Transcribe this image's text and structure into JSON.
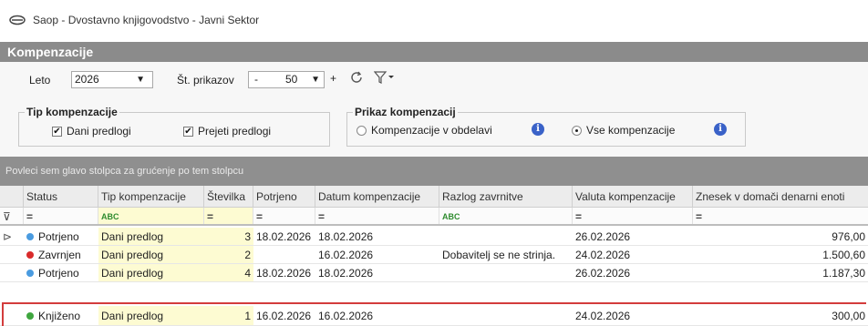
{
  "window": {
    "title": "Saop - Dvostavno knjigovodstvo - Javni Sektor"
  },
  "panel": {
    "title": "Kompenzacije"
  },
  "toolbar": {
    "year_label": "Leto",
    "year_value": "2026",
    "count_label": "Št. prikazov",
    "count_minus": "-",
    "count_value": "50",
    "count_plus": "+"
  },
  "tip_group": {
    "title": "Tip kompenzacije",
    "option1": "Dani predlogi",
    "option2": "Prejeti predlogi"
  },
  "prikaz_group": {
    "title": "Prikaz kompenzacij",
    "option1": "Kompenzacije v obdelavi",
    "option2": "Vse kompenzacije"
  },
  "group_bar": {
    "text": "Povleci sem glavo stolpca za grućenje po tem stolpcu"
  },
  "columns": [
    "Status",
    "Tip kompenzacije",
    "Številka",
    "Potrjeno",
    "Datum kompenzacije",
    "Razlog zavrnitve",
    "Valuta kompenzacije",
    "Znesek v domači denarni enoti"
  ],
  "filter_row": [
    "=",
    "ABC",
    "=",
    "=",
    "=",
    "ABC",
    "=",
    "="
  ],
  "rows": [
    {
      "status": "Potrjeno",
      "status_color": "#4a9be0",
      "tip": "Dani predlog",
      "stevilka": "3",
      "potrjeno": "18.02.2026",
      "datum": "18.02.2026",
      "razlog": "",
      "valuta": "26.02.2026",
      "znesek": "976,00"
    },
    {
      "status": "Zavrnjen",
      "status_color": "#d92b2b",
      "tip": "Dani predlog",
      "stevilka": "2",
      "potrjeno": "",
      "datum": "16.02.2026",
      "razlog": "Dobavitelj se ne strinja.",
      "valuta": "24.02.2026",
      "znesek": "1.500,60"
    },
    {
      "status": "Potrjeno",
      "status_color": "#4a9be0",
      "tip": "Dani predlog",
      "stevilka": "4",
      "potrjeno": "18.02.2026",
      "datum": "18.02.2026",
      "razlog": "",
      "valuta": "26.02.2026",
      "znesek": "1.187,30"
    },
    {
      "status": "Knjiženo",
      "status_color": "#3fa63f",
      "tip": "Dani predlog",
      "stevilka": "1",
      "potrjeno": "16.02.2026",
      "datum": "16.02.2026",
      "razlog": "",
      "valuta": "24.02.2026",
      "znesek": "300,00"
    }
  ],
  "colors": {
    "header_bg": "#8b8b8b",
    "group_bar_bg": "#8f8f8f",
    "highlight_border": "#d33c3c",
    "info_icon": "#3a62c8"
  }
}
